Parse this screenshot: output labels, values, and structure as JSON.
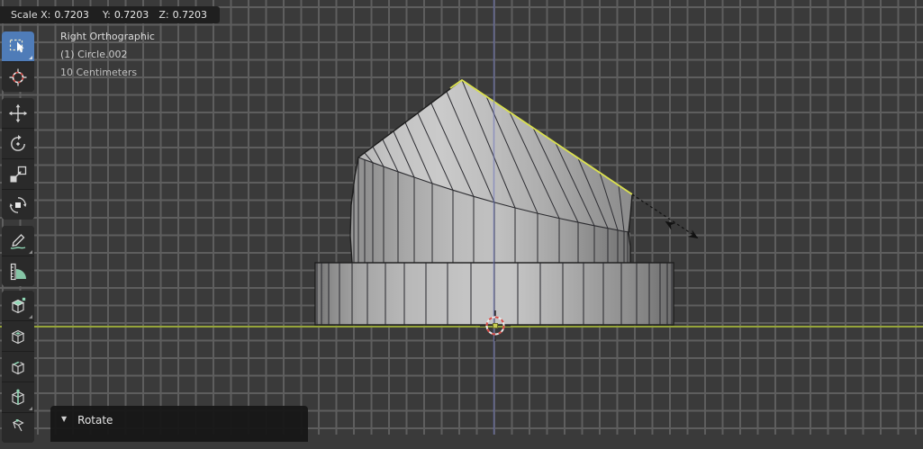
{
  "header": {
    "transform_status": {
      "x_label": "Scale X:",
      "x_value": "0.7203",
      "y_label": "Y:",
      "y_value": "0.7203",
      "z_label": "Z:",
      "z_value": "0.7203"
    }
  },
  "viewport_overlay": {
    "view_name": "Right Orthographic",
    "active_object": "(1) Circle.002",
    "grid_scale": "10 Centimeters"
  },
  "toolbar": {
    "tools": [
      {
        "id": "select-box",
        "label": "Select Box",
        "active": true
      },
      {
        "id": "cursor",
        "label": "Cursor",
        "active": false
      },
      {
        "id": "move",
        "label": "Move",
        "active": false
      },
      {
        "id": "rotate",
        "label": "Rotate",
        "active": false
      },
      {
        "id": "scale",
        "label": "Scale",
        "active": false
      },
      {
        "id": "transform",
        "label": "Transform",
        "active": false
      },
      {
        "id": "annotate",
        "label": "Annotate",
        "active": false
      },
      {
        "id": "measure",
        "label": "Measure",
        "active": false
      },
      {
        "id": "extrude-region",
        "label": "Extrude Region",
        "active": false
      },
      {
        "id": "inset-faces",
        "label": "Inset Faces",
        "active": false
      },
      {
        "id": "bevel",
        "label": "Bevel",
        "active": false
      },
      {
        "id": "loop-cut",
        "label": "Loop Cut",
        "active": false
      },
      {
        "id": "knife",
        "label": "Knife",
        "active": false
      }
    ]
  },
  "operator_panel": {
    "collapse_icon": "▼",
    "label": "Rotate"
  },
  "scene": {
    "mesh_object": "Circle.002",
    "selected_edge_color": "#dce24f",
    "axis_y_color": "#96a53a",
    "axis_z_color": "#6973be",
    "active_tool_color": "#4f7cb8",
    "tool_accent_color": "#8fd6b4",
    "cursor_red": "#d84a45"
  }
}
